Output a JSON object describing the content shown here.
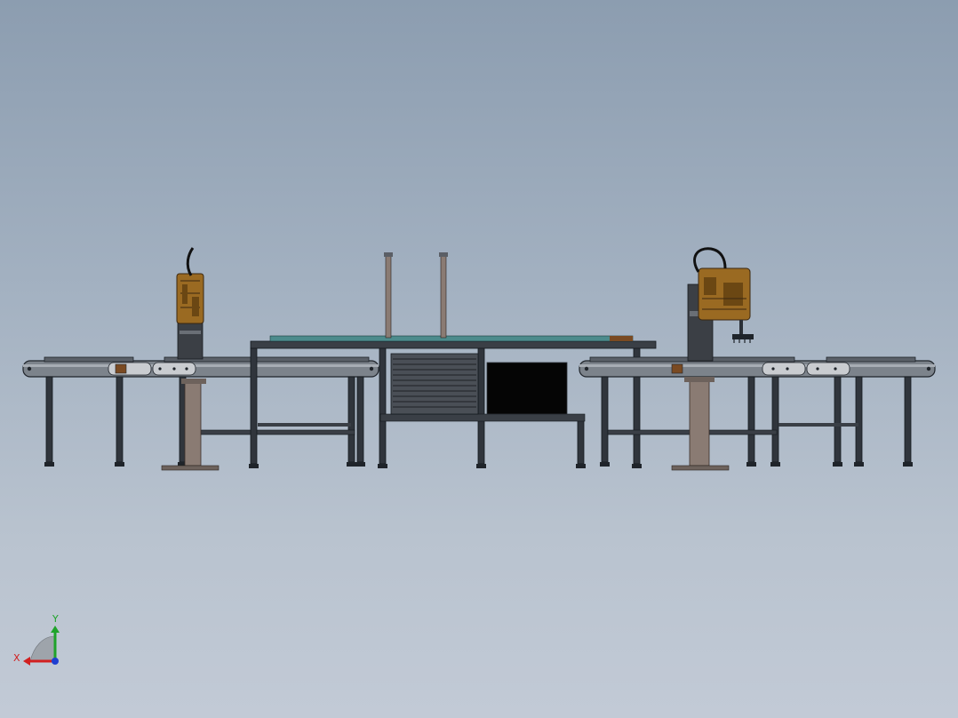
{
  "view": {
    "background_top": "#8c9db0",
    "background_bottom": "#c2cad6"
  },
  "triad": {
    "x_label": "X",
    "y_label": "Y",
    "x_color": "#d12020",
    "y_color": "#1fa32a",
    "z_color": "#1f3fd1"
  },
  "model": {
    "components": [
      "left-conveyor",
      "left-scara-robot",
      "center-workbench",
      "right-scara-robot",
      "right-conveyor"
    ],
    "colors": {
      "frame": "#2a2f36",
      "belt": "#7c838b",
      "robot_body": "#9a6a22",
      "robot_dark": "#3b3f45",
      "pedestal": "#8a7b73",
      "monitor": "#050505",
      "panel": "#4a4f56",
      "table_top": "#4c8b8c"
    }
  }
}
